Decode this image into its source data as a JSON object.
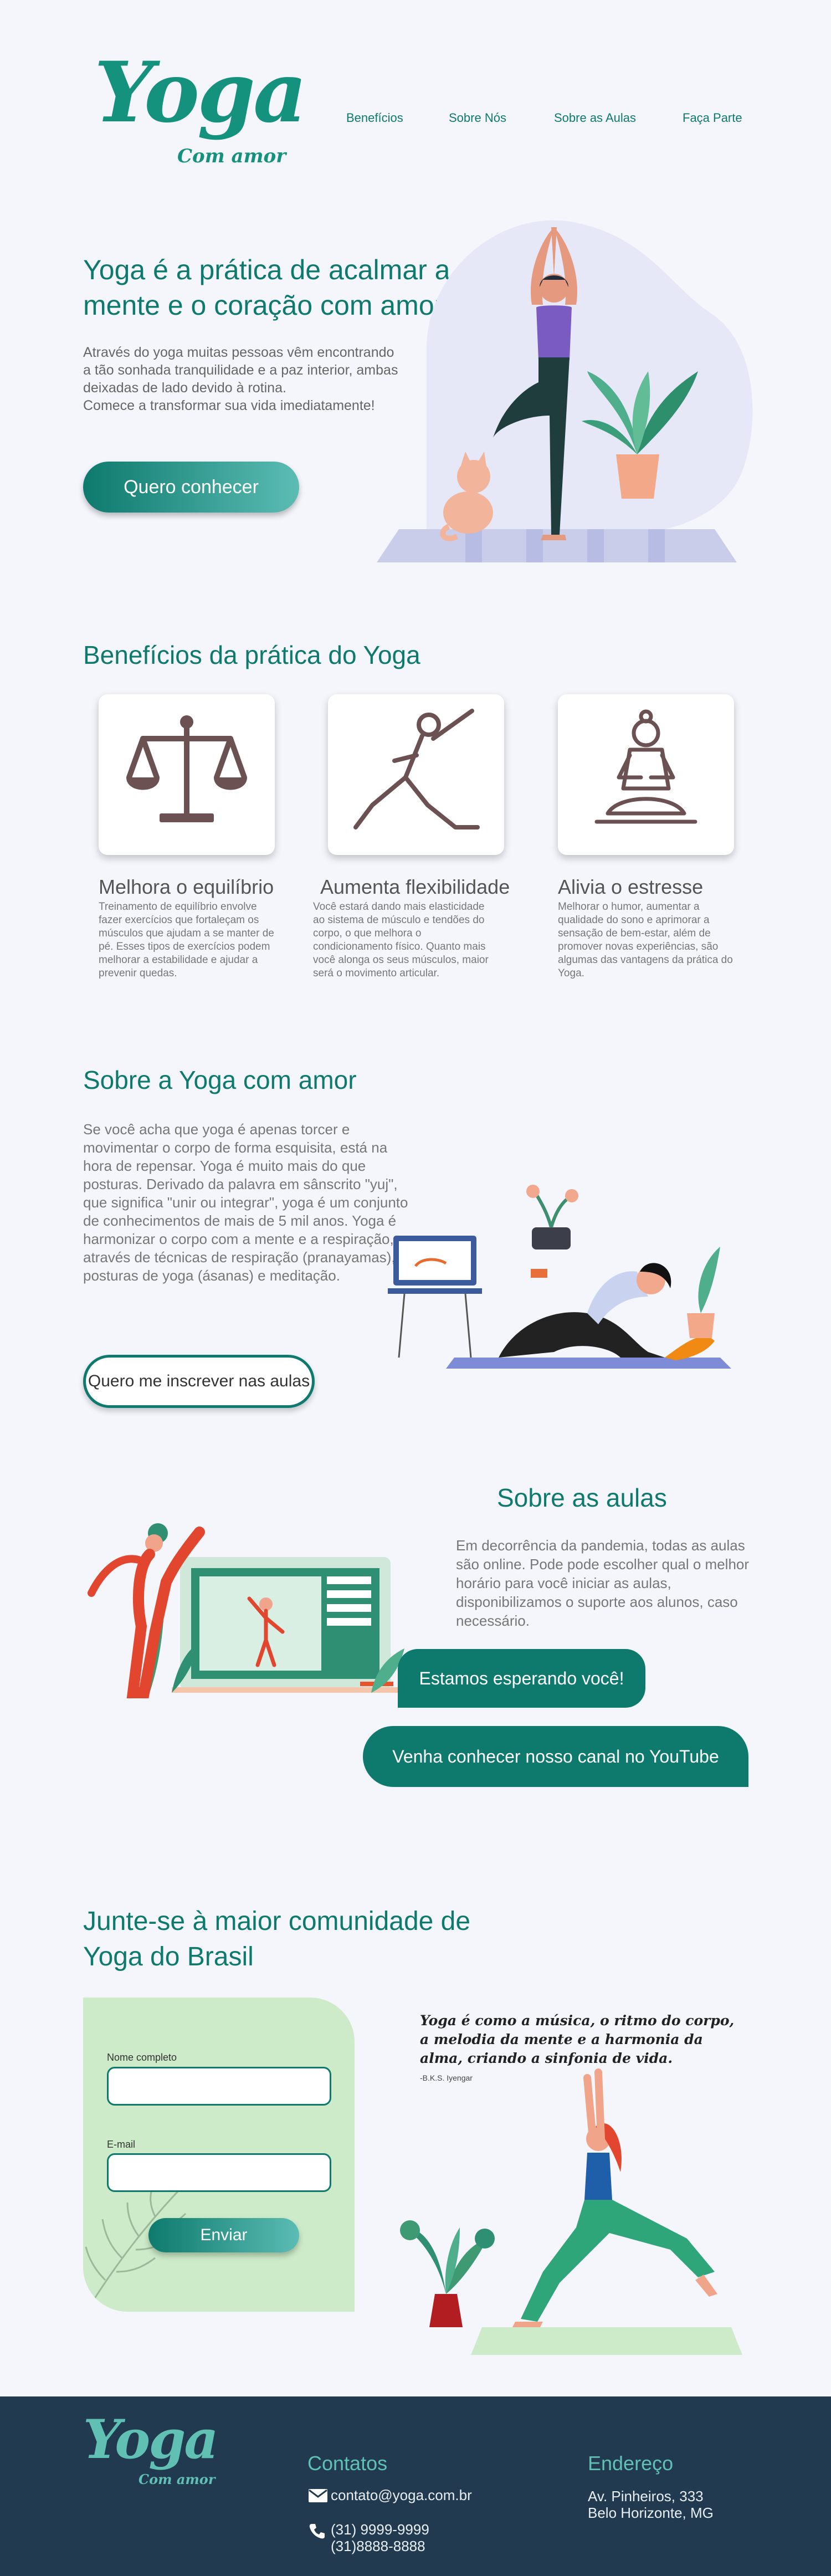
{
  "brand": {
    "logo": "Yoga",
    "tagline": "Com amor"
  },
  "nav": {
    "items": [
      "Benefícios",
      "Sobre Nós",
      "Sobre as Aulas",
      "Faça Parte"
    ]
  },
  "hero": {
    "title": "Yoga é a prática de acalmar a mente e o coração com amor",
    "text_lines": [
      "Através do yoga muitas pessoas vêm encontrando",
      "a tão sonhada tranquilidade e a paz interior, ambas",
      "deixadas de lado devido à rotina.",
      "Comece a transformar sua vida imediatamente!"
    ],
    "button": "Quero conhecer"
  },
  "benefits": {
    "title": "Benefícios da prática do Yoga",
    "items": [
      {
        "title": "Melhora o equilíbrio",
        "icon": "balance-scale-icon",
        "text": "Treinamento de equilíbrio envolve fazer exercícios que fortaleçam os músculos que ajudam a se manter de pé. Esses tipos de exercícios podem melhorar a estabilidade e ajudar a prevenir quedas."
      },
      {
        "title": "Aumenta flexibilidade",
        "icon": "stretching-pose-icon",
        "text": "Você estará dando mais elasticidade ao sistema de músculo e tendões do corpo, o que melhora o condicionamento físico. Quanto mais você alonga os seus músculos, maior será o movimento articular."
      },
      {
        "title": "Alivia o estresse",
        "icon": "meditation-pose-icon",
        "text": "Melhorar o humor, aumentar a qualidade do sono e aprimorar a sensação de bem-estar, além de promover novas experiências, são algumas das vantagens da prática do Yoga."
      }
    ]
  },
  "about": {
    "title": "Sobre a Yoga com amor",
    "text": "Se você acha que yoga é apenas torcer e movimentar o corpo de forma esquisita, está na hora de repensar. Yoga é muito mais do que posturas. Derivado da palavra em sânscrito \"yuj\", que significa \"unir ou integrar\", yoga é um conjunto de conhecimentos de mais de 5 mil anos. Yoga é harmonizar o corpo com a mente e a respiração, através de técnicas de respiração (pranayamas), posturas de yoga (ásanas) e meditação.",
    "button": "Quero me inscrever nas aulas"
  },
  "classes": {
    "title": "Sobre as aulas",
    "text": "Em decorrência da pandemia, todas as aulas são online. Pode pode escolher qual o melhor horário para você iniciar as aulas, disponibilizamos o suporte aos alunos, caso necessário.",
    "bubble1": "Estamos esperando você!",
    "bubble2": "Venha conhecer nosso canal no YouTube"
  },
  "join": {
    "title": "Junte-se à maior comunidade de Yoga do Brasil",
    "name_label": "Nome completo",
    "email_label": "E-mail",
    "button": "Enviar",
    "quote": "Yoga é como a música, o ritmo do corpo, a melodia da mente e a harmonia da alma, criando a sinfonia de vida.",
    "quote_author": "-B.K.S. Iyengar"
  },
  "footer": {
    "logo": "Yoga",
    "tagline": "Com amor",
    "contacts_title": "Contatos",
    "email": "contato@yoga.com.br",
    "phone1": "(31) 9999-9999",
    "phone2": "(31)8888-8888",
    "address_title": "Endereço",
    "address1": "Av. Pinheiros, 333",
    "address2": "Belo Horizonte, MG"
  },
  "colors": {
    "primary": "#0e7a6e",
    "accent": "#5fc0b3",
    "footer": "#213a4f",
    "form": "#cdebc8"
  }
}
